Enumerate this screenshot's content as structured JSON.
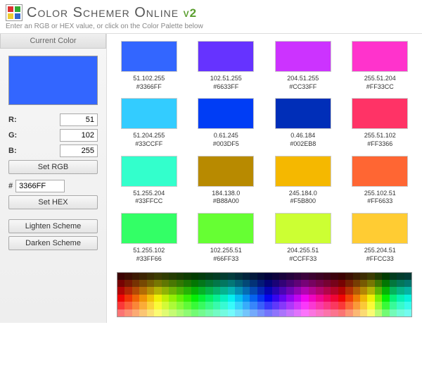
{
  "header": {
    "title_main": "Color Schemer Online",
    "title_suffix": "v2",
    "subtitle": "Enter an RGB or HEX value, or click on the Color Palette below"
  },
  "sidebar": {
    "current_color_label": "Current Color",
    "current_color_hex": "#3366FF",
    "rgb": {
      "r_label": "R:",
      "g_label": "G:",
      "b_label": "B:",
      "r": "51",
      "g": "102",
      "b": "255"
    },
    "set_rgb_label": "Set RGB",
    "hex_label": "#",
    "hex_value": "3366FF",
    "set_hex_label": "Set HEX",
    "lighten_label": "Lighten Scheme",
    "darken_label": "Darken Scheme"
  },
  "swatches": [
    {
      "rgb": "51.102.255",
      "hex": "#3366FF"
    },
    {
      "rgb": "102.51.255",
      "hex": "#6633FF"
    },
    {
      "rgb": "204.51.255",
      "hex": "#CC33FF"
    },
    {
      "rgb": "255.51.204",
      "hex": "#FF33CC"
    },
    {
      "rgb": "51.204.255",
      "hex": "#33CCFF"
    },
    {
      "rgb": "0.61.245",
      "hex": "#003DF5"
    },
    {
      "rgb": "0.46.184",
      "hex": "#002EB8"
    },
    {
      "rgb": "255.51.102",
      "hex": "#FF3366"
    },
    {
      "rgb": "51.255.204",
      "hex": "#33FFCC"
    },
    {
      "rgb": "184.138.0",
      "hex": "#B88A00"
    },
    {
      "rgb": "245.184.0",
      "hex": "#F5B800"
    },
    {
      "rgb": "255.102.51",
      "hex": "#FF6633"
    },
    {
      "rgb": "51.255.102",
      "hex": "#33FF66"
    },
    {
      "rgb": "102.255.51",
      "hex": "#66FF33"
    },
    {
      "rgb": "204.255.51",
      "hex": "#CCFF33"
    },
    {
      "rgb": "255.204.51",
      "hex": "#FFCC33"
    }
  ],
  "palette_hues": [
    0,
    12,
    24,
    36,
    48,
    60,
    72,
    84,
    96,
    108,
    120,
    132,
    144,
    156,
    168,
    180,
    192,
    204,
    216,
    228,
    240,
    252,
    264,
    276,
    288,
    300,
    312,
    324,
    336,
    348,
    0,
    15,
    30,
    45,
    60,
    90,
    120,
    150,
    165,
    175
  ]
}
